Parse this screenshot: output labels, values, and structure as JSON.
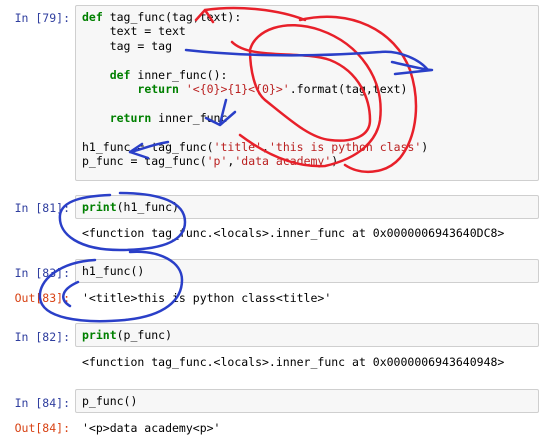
{
  "cells": [
    {
      "prompt": "In [79]:",
      "lines": [
        [
          {
            "t": "def ",
            "c": "kw"
          },
          {
            "t": "tag_func(tag,text):"
          }
        ],
        [
          {
            "t": "    text = text"
          }
        ],
        [
          {
            "t": "    tag = tag"
          }
        ],
        [
          {
            "t": ""
          }
        ],
        [
          {
            "t": "    "
          },
          {
            "t": "def ",
            "c": "kw"
          },
          {
            "t": "inner_func():"
          }
        ],
        [
          {
            "t": "        "
          },
          {
            "t": "return ",
            "c": "kw"
          },
          {
            "t": "'<{0}>{1}<{0}>'",
            "c": "str"
          },
          {
            "t": ".format(tag,text)"
          }
        ],
        [
          {
            "t": ""
          }
        ],
        [
          {
            "t": "    "
          },
          {
            "t": "return ",
            "c": "kw"
          },
          {
            "t": "inner_func"
          }
        ],
        [
          {
            "t": ""
          }
        ],
        [
          {
            "t": "h1_func = tag_func("
          },
          {
            "t": "'title'",
            "c": "str"
          },
          {
            "t": ","
          },
          {
            "t": "'this is python class'",
            "c": "str"
          },
          {
            "t": ")"
          }
        ],
        [
          {
            "t": "p_func = tag_func("
          },
          {
            "t": "'p'",
            "c": "str"
          },
          {
            "t": ","
          },
          {
            "t": "'data academy'",
            "c": "str"
          },
          {
            "t": ")"
          }
        ]
      ]
    },
    {
      "prompt": "In [81]:",
      "lines": [
        [
          {
            "t": "print",
            "c": "kw"
          },
          {
            "t": "(h1_func)"
          }
        ]
      ],
      "stdout": "<function tag_func.<locals>.inner_func at 0x0000006943640DC8>"
    },
    {
      "prompt": "In [83]:",
      "lines": [
        [
          {
            "t": "h1_func()"
          }
        ]
      ],
      "out_prompt": "Out[83]:",
      "output": "'<title>this is python class<title>'"
    },
    {
      "prompt": "In [82]:",
      "lines": [
        [
          {
            "t": "print",
            "c": "kw"
          },
          {
            "t": "(p_func)"
          }
        ]
      ],
      "stdout": "<function tag_func.<locals>.inner_func at 0x0000006943640948>"
    },
    {
      "prompt": "In [84]:",
      "lines": [
        [
          {
            "t": "p_func()"
          }
        ]
      ],
      "out_prompt": "Out[84]:",
      "output": "'<p>data academy<p>'"
    }
  ],
  "annotation_colors": {
    "red": "#e8202a",
    "blue": "#2a3fc8"
  }
}
